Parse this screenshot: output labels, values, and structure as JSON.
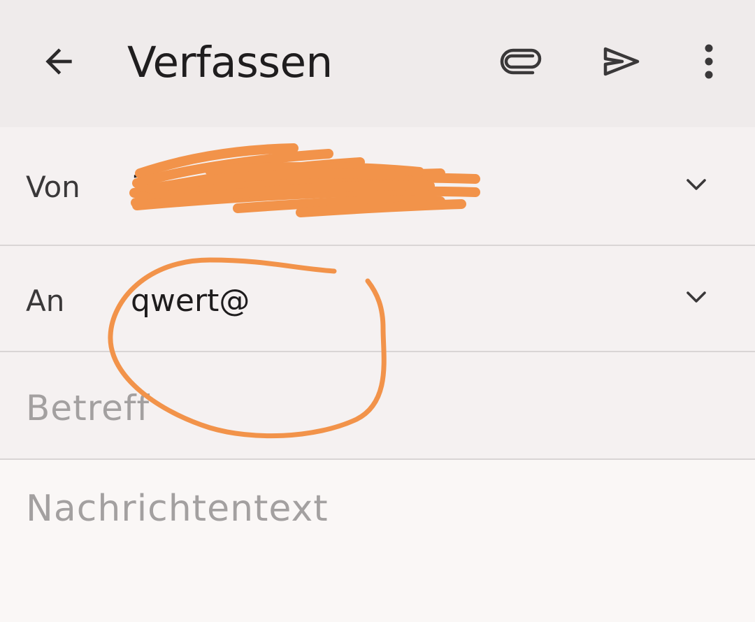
{
  "appbar": {
    "title": "Verfassen",
    "icons": [
      "arrow-back-icon",
      "paperclip-icon",
      "send-icon",
      "more-vert-icon"
    ]
  },
  "from": {
    "label": "Von",
    "value": "1"
  },
  "to": {
    "label": "An",
    "value": "qwert@"
  },
  "subject": {
    "placeholder": "Betreff",
    "value": ""
  },
  "body": {
    "placeholder": "Nachrichtentext",
    "value": ""
  },
  "colors": {
    "appbar_bg": "#efebeb",
    "field_bg": "#f5f1f1",
    "annotation": "#f2934a",
    "placeholder": "#a3a0a0"
  }
}
